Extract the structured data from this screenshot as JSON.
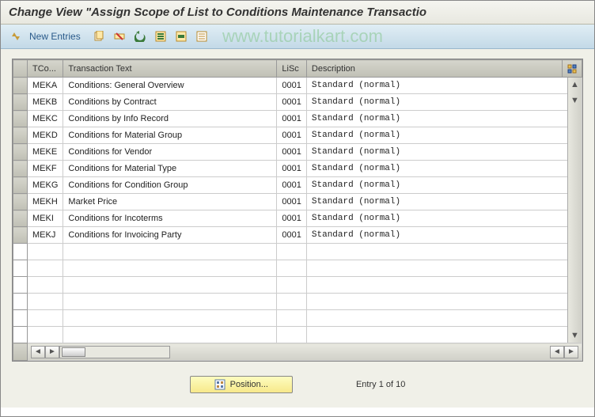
{
  "title": "Change View \"Assign Scope of List to Conditions Maintenance Transactio",
  "watermark": "www.tutorialkart.com",
  "toolbar": {
    "new_entries_label": "New Entries"
  },
  "columns": {
    "tcode": "TCo...",
    "ttext": "Transaction Text",
    "lisc": "LiSc",
    "desc": "Description"
  },
  "rows": [
    {
      "tcode": "MEKA",
      "ttext": "Conditions: General Overview",
      "lisc": "0001",
      "desc": "Standard (normal)"
    },
    {
      "tcode": "MEKB",
      "ttext": "Conditions by Contract",
      "lisc": "0001",
      "desc": "Standard (normal)"
    },
    {
      "tcode": "MEKC",
      "ttext": "Conditions by Info Record",
      "lisc": "0001",
      "desc": "Standard (normal)"
    },
    {
      "tcode": "MEKD",
      "ttext": "Conditions for Material Group",
      "lisc": "0001",
      "desc": "Standard (normal)"
    },
    {
      "tcode": "MEKE",
      "ttext": "Conditions for Vendor",
      "lisc": "0001",
      "desc": "Standard (normal)"
    },
    {
      "tcode": "MEKF",
      "ttext": "Conditions for Material Type",
      "lisc": "0001",
      "desc": "Standard (normal)"
    },
    {
      "tcode": "MEKG",
      "ttext": "Conditions for Condition Group",
      "lisc": "0001",
      "desc": "Standard (normal)"
    },
    {
      "tcode": "MEKH",
      "ttext": "Market Price",
      "lisc": "0001",
      "desc": "Standard (normal)"
    },
    {
      "tcode": "MEKI",
      "ttext": "Conditions for Incoterms",
      "lisc": "0001",
      "desc": "Standard (normal)"
    },
    {
      "tcode": "MEKJ",
      "ttext": "Conditions for Invoicing Party",
      "lisc": "0001",
      "desc": "Standard (normal)"
    }
  ],
  "empty_row_count": 6,
  "footer": {
    "position_label": "Position...",
    "entry_text": "Entry 1 of 10"
  }
}
